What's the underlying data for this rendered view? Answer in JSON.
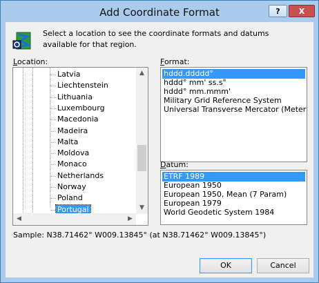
{
  "window": {
    "title": "Add Coordinate Format",
    "help_label": "?",
    "close_label": "X"
  },
  "intro_text": "Select a location to see the coordinate formats and datums available for that region.",
  "location": {
    "label_accel": "L",
    "label_rest": "ocation:",
    "items": [
      "Latvia",
      "Liechtenstein",
      "Lithuania",
      "Luxembourg",
      "Macedonia",
      "Madeira",
      "Malta",
      "Moldova",
      "Monaco",
      "Netherlands",
      "Norway",
      "Poland",
      "Portugal"
    ],
    "selected": "Portugal"
  },
  "format": {
    "label_accel": "F",
    "label_rest": "ormat:",
    "items": [
      "hddd.ddddd°",
      "hddd° mm' ss.s\"",
      "hddd° mm.mmm'",
      "Military Grid Reference System",
      "Universal Transverse Mercator (Meters)"
    ],
    "selected": "hddd.ddddd°"
  },
  "datum": {
    "label_accel": "D",
    "label_rest": "atum:",
    "items": [
      "ETRF 1989",
      "European 1950",
      "European 1950, Mean (7 Param)",
      "European 1979",
      "World Geodetic System 1984"
    ],
    "selected": "ETRF 1989"
  },
  "sample_text": "Sample: N38.71462°  W009.13845° (at N38.71462°  W009.13845°)",
  "buttons": {
    "ok": "OK",
    "cancel": "Cancel"
  },
  "icons": {
    "app_icon": "globe-map-icon",
    "scroll_up": "scroll-up-arrow-icon",
    "scroll_down": "scroll-down-arrow-icon",
    "scroll_left": "scroll-left-arrow-icon",
    "scroll_right": "scroll-right-arrow-icon"
  },
  "colors": {
    "selection": "#3399ff",
    "titlebar": "#aacbeb",
    "close_button": "#c75050"
  }
}
